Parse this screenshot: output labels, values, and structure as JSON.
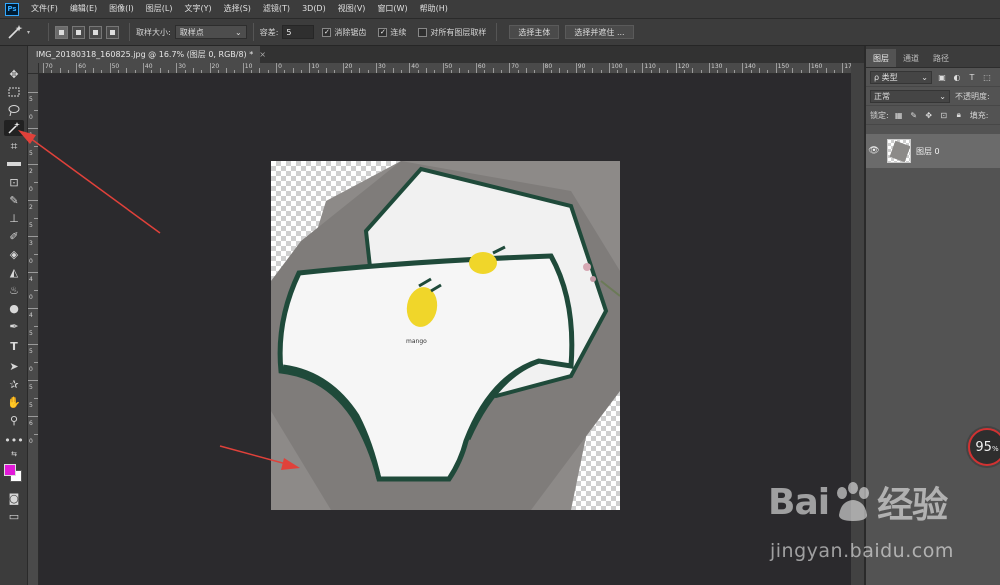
{
  "menu": {
    "logo_text": "Ps",
    "items": [
      "文件(F)",
      "编辑(E)",
      "图像(I)",
      "图层(L)",
      "文字(Y)",
      "选择(S)",
      "滤镜(T)",
      "3D(D)",
      "视图(V)",
      "窗口(W)",
      "帮助(H)"
    ]
  },
  "options": {
    "sample_size_label": "取样大小:",
    "sample_size_value": "取样点",
    "tolerance_label": "容差:",
    "tolerance_value": "5",
    "antialias_label": "消除锯齿",
    "antialias_checked": true,
    "contiguous_label": "连续",
    "contiguous_checked": true,
    "all_layers_label": "对所有图层取样",
    "all_layers_checked": false,
    "select_subject_label": "选择主体",
    "select_mask_label": "选择并遮住 ..."
  },
  "document": {
    "tab_title": "IMG_20180318_160825.jpg @ 16.7% (图层 0, RGB/8) *",
    "close_glyph": "×"
  },
  "ruler": {
    "h_labels": [
      "70",
      "60",
      "50",
      "40",
      "30",
      "20",
      "10",
      "0",
      "10",
      "20",
      "30",
      "40",
      "50",
      "60",
      "70",
      "80",
      "90",
      "100",
      "110",
      "120",
      "130",
      "140",
      "150",
      "160",
      "170"
    ],
    "v_labels": [
      "5",
      "0",
      "1",
      "5",
      "2",
      "0",
      "2",
      "5",
      "3",
      "0",
      "4",
      "0",
      "4",
      "5",
      "5",
      "0",
      "5",
      "5",
      "6",
      "0"
    ]
  },
  "layers_panel": {
    "tabs": [
      "图层",
      "通道",
      "路径"
    ],
    "filter_label": "ρ 类型",
    "blend_mode": "正常",
    "opacity_label": "不透明度:",
    "lock_label": "锁定:",
    "fill_label": "填充:",
    "layer_name": "图层 0"
  },
  "overlay": {
    "percent_value": "95",
    "percent_unit": "%"
  },
  "watermark": {
    "brand": "Bai",
    "brand_tail": "经验",
    "url": "jingyan.baidu.com"
  },
  "colors": {
    "foreground": "#e21ad9",
    "background": "#ffffff",
    "arrow": "#e0413a"
  }
}
